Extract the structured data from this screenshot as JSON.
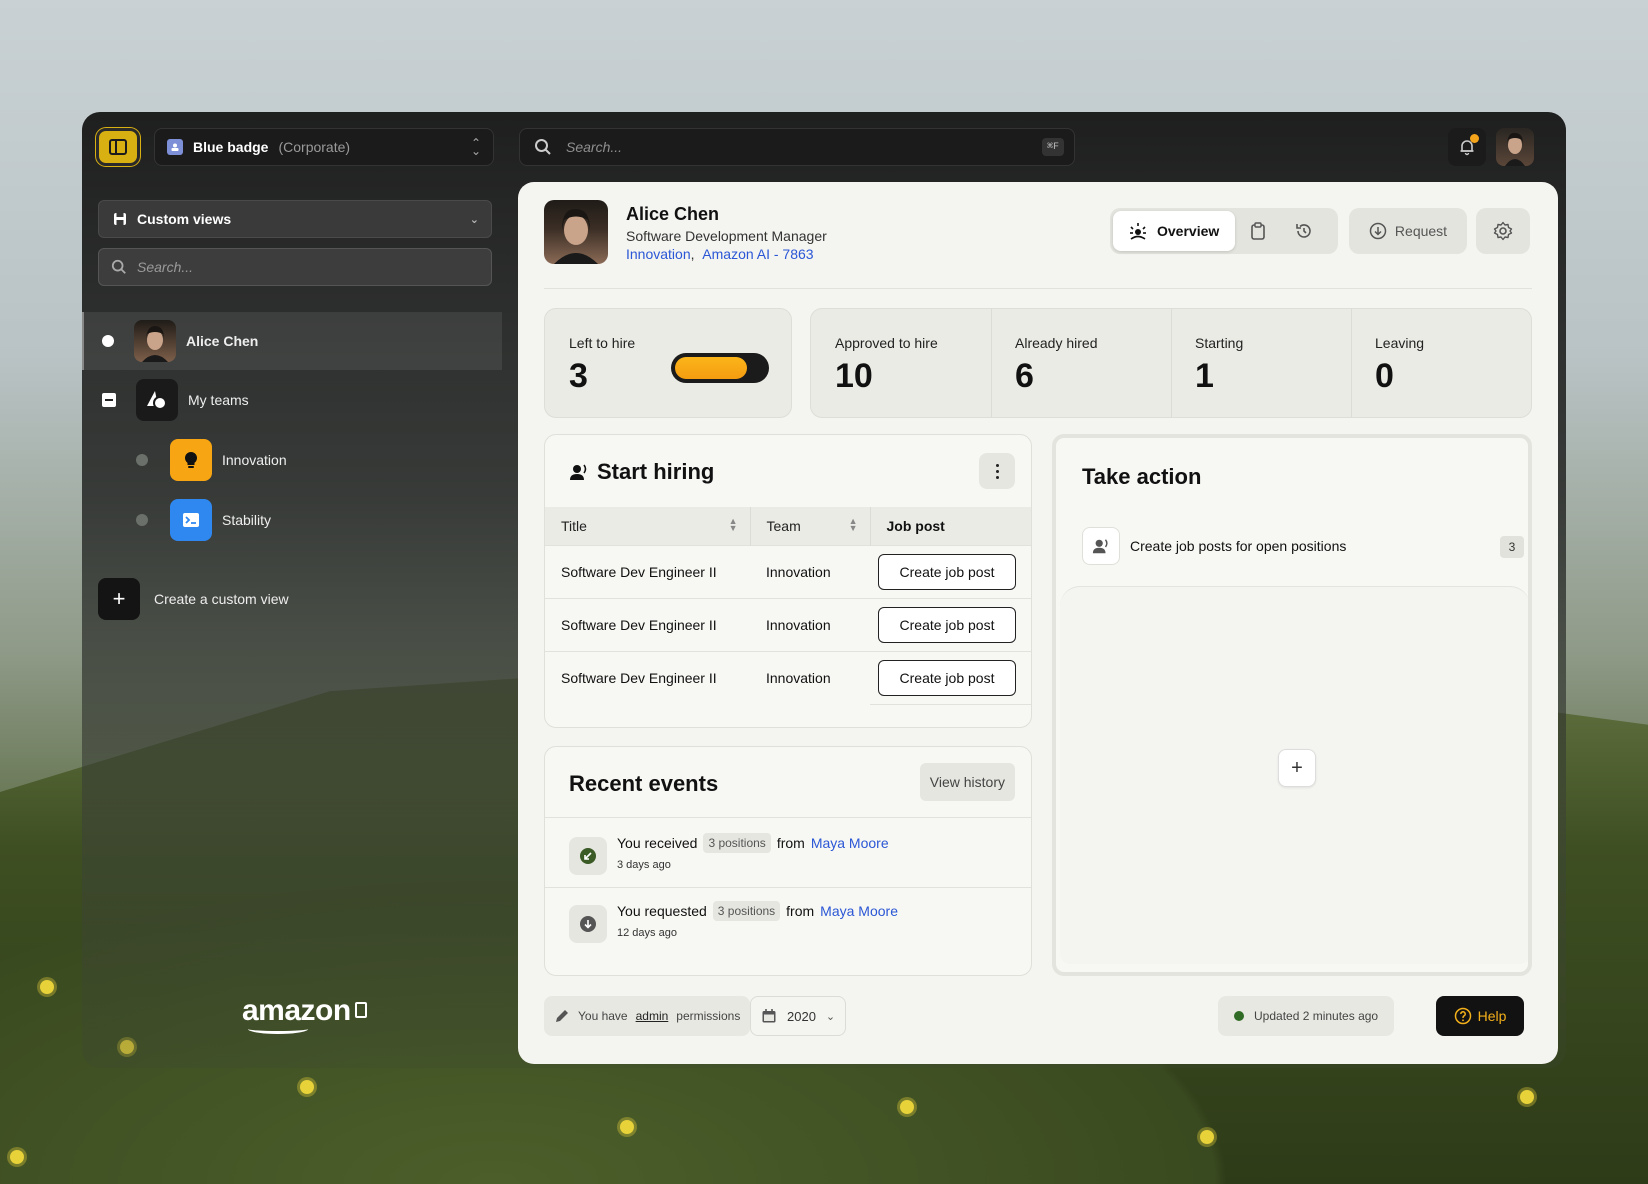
{
  "org": {
    "name": "Blue badge",
    "type": "(Corporate)"
  },
  "search": {
    "placeholder": "Search...",
    "shortcut": "⌘F"
  },
  "sidebar": {
    "views_label": "Custom views",
    "search_placeholder": "Search...",
    "items": [
      {
        "label": "Alice Chen"
      },
      {
        "label": "My teams"
      },
      {
        "label": "Innovation",
        "color": "#f7a513"
      },
      {
        "label": "Stability",
        "color": "#2f87f0"
      }
    ],
    "create_label": "Create a custom view",
    "logo": "amazon"
  },
  "profile": {
    "name": "Alice Chen",
    "role": "Software Development Manager",
    "team": "Innovation",
    "org": "Amazon AI - 7863"
  },
  "tabs": {
    "overview": "Overview",
    "request": "Request"
  },
  "stats": {
    "left_to_hire": {
      "label": "Left to hire",
      "value": "3",
      "progress": 0.8
    },
    "approved": {
      "label": "Approved to hire",
      "value": "10"
    },
    "hired": {
      "label": "Already hired",
      "value": "6"
    },
    "starting": {
      "label": "Starting",
      "value": "1"
    },
    "leaving": {
      "label": "Leaving",
      "value": "0"
    }
  },
  "hiring": {
    "title": "Start hiring",
    "columns": [
      "Title",
      "Team",
      "Job post"
    ],
    "rows": [
      {
        "title": "Software Dev Engineer II",
        "team": "Innovation",
        "action": "Create job post"
      },
      {
        "title": "Software Dev Engineer II",
        "team": "Innovation",
        "action": "Create job post"
      },
      {
        "title": "Software Dev Engineer II",
        "team": "Innovation",
        "action": "Create job post"
      }
    ]
  },
  "events": {
    "title": "Recent events",
    "view_history": "View history",
    "items": [
      {
        "verb": "You received",
        "chip": "3 positions",
        "from": "from",
        "person": "Maya Moore",
        "time": "3 days ago"
      },
      {
        "verb": "You requested",
        "chip": "3 positions",
        "from": "from",
        "person": "Maya Moore",
        "time": "12 days ago"
      }
    ]
  },
  "actions": {
    "title": "Take action",
    "items": [
      {
        "label": "Create job posts for open positions",
        "count": "3"
      }
    ]
  },
  "footer": {
    "perm_prefix": "You have",
    "perm_role": "admin",
    "perm_suffix": "permissions",
    "year": "2020",
    "updated": "Updated 2 minutes ago",
    "help": "Help"
  },
  "colors": {
    "accent": "#f4a41b",
    "link": "#2b57d6",
    "status": "#2f6b24"
  }
}
